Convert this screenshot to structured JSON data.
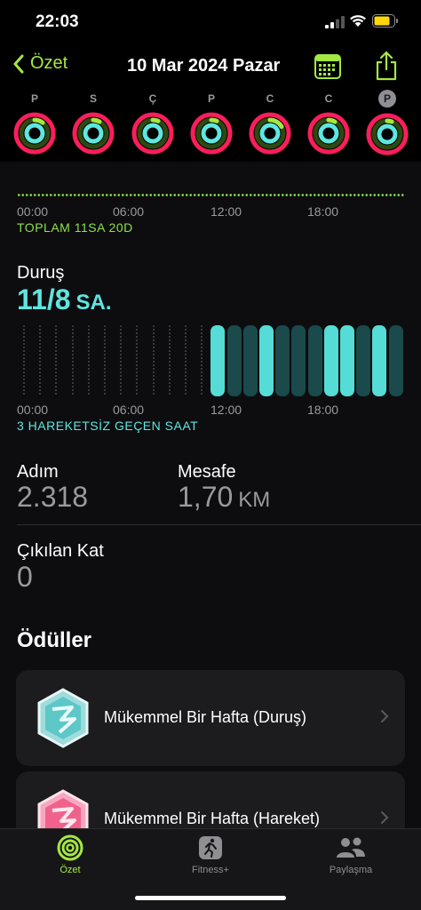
{
  "status": {
    "time": "22:03"
  },
  "nav": {
    "back_label": "Özet",
    "title": "10 Mar 2024 Pazar"
  },
  "week": [
    {
      "letter": "P",
      "today": false
    },
    {
      "letter": "S",
      "today": false
    },
    {
      "letter": "Ç",
      "today": false
    },
    {
      "letter": "P",
      "today": false
    },
    {
      "letter": "C",
      "today": false
    },
    {
      "letter": "C",
      "today": false
    },
    {
      "letter": "P",
      "today": true
    }
  ],
  "activity_chart": {
    "ticks": [
      "00:00",
      "06:00",
      "12:00",
      "18:00"
    ],
    "total_label": "TOPLAM 11SA 20D"
  },
  "stand": {
    "label": "Duruş",
    "value": "11/8",
    "unit": "SA.",
    "ticks": [
      "00:00",
      "06:00",
      "12:00",
      "18:00"
    ],
    "idle_label": "3 HAREKETSİZ GEÇEN SAAT",
    "hours": [
      0,
      0,
      0,
      0,
      0,
      0,
      0,
      0,
      0,
      0,
      0,
      0,
      2,
      1,
      1,
      2,
      1,
      1,
      1,
      2,
      2,
      1,
      2,
      1
    ]
  },
  "stats": {
    "steps_label": "Adım",
    "steps_value": "2.318",
    "distance_label": "Mesafe",
    "distance_value": "1,70",
    "distance_unit": "KM",
    "floors_label": "Çıkılan Kat",
    "floors_value": "0"
  },
  "awards": {
    "title": "Ödüller",
    "items": [
      {
        "name": "Mükemmel Bir Hafta (Duruş)",
        "color": "#6fd6d6"
      },
      {
        "name": "Mükemmel Bir Hafta (Hareket)",
        "color": "#ff5a8a"
      }
    ]
  },
  "tabs": [
    {
      "label": "Özet",
      "icon": "activity-rings-icon",
      "active": true
    },
    {
      "label": "Fitness+",
      "icon": "running-figure-icon",
      "active": false
    },
    {
      "label": "Paylaşma",
      "icon": "people-icon",
      "active": false
    }
  ],
  "colors": {
    "move": "#fa1e5a",
    "exercise": "#a5e843",
    "stand": "#5ee6e0",
    "accent": "#a5e843"
  }
}
